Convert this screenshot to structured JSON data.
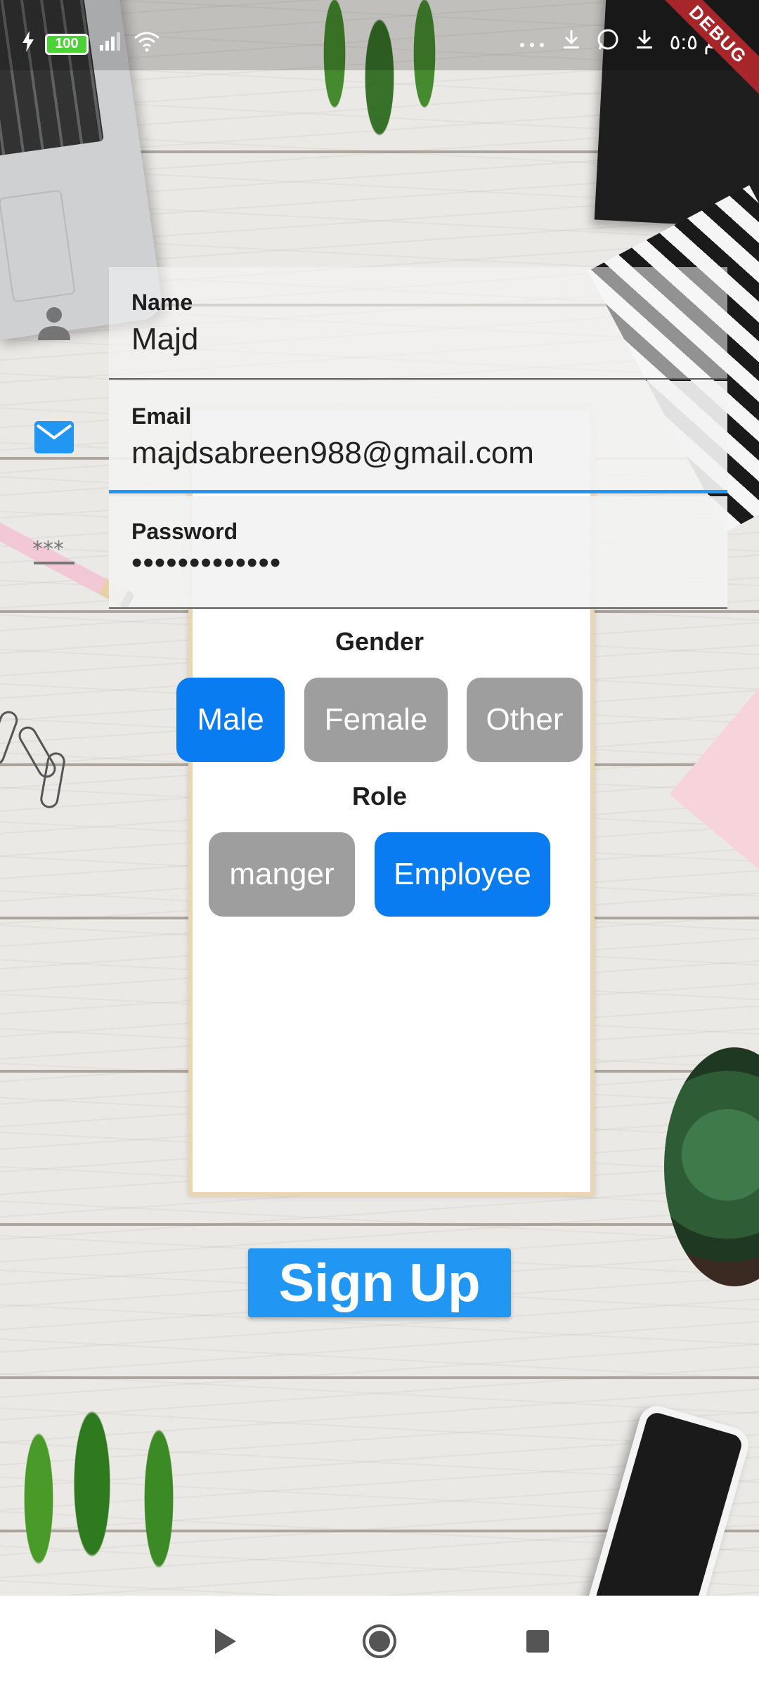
{
  "status_bar": {
    "battery": "100",
    "time": "م ٥:٥",
    "debug_label": "DEBUG"
  },
  "form": {
    "name": {
      "label": "Name",
      "value": "Majd"
    },
    "email": {
      "label": "Email",
      "value": "majdsabreen988@gmail.com"
    },
    "password": {
      "label": "Password",
      "value": "•••••••••••••"
    }
  },
  "gender": {
    "title": "Gender",
    "options": [
      "Male",
      "Female",
      "Other"
    ],
    "selected": "Male"
  },
  "role": {
    "title": "Role",
    "options": [
      "manger",
      "Employee"
    ],
    "selected": "Employee"
  },
  "signup_label": "Sign Up",
  "icons": {
    "name": "person-icon",
    "email": "mail-icon",
    "password": "password-icon"
  },
  "colors": {
    "accent": "#2196f3",
    "selected_chip": "#0a7cf2",
    "unselected_chip": "#9e9e9e",
    "debug_ribbon": "#a6262a"
  }
}
